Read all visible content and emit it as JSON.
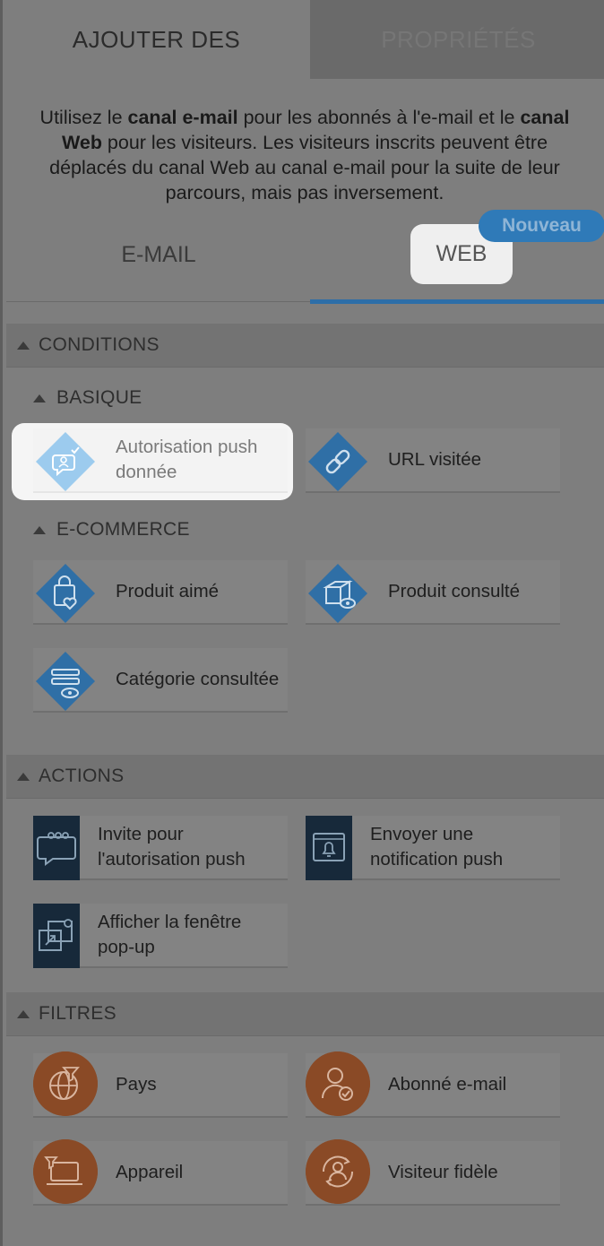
{
  "tabs": {
    "add": "AJOUTER DES",
    "properties": "PROPRIÉTÉS"
  },
  "intro": {
    "p1": "Utilisez le ",
    "b1": "canal e-mail",
    "p2": " pour les abonnés à l'e-mail et le ",
    "b2": "canal Web",
    "p3": " pour les visiteurs. Les visiteurs inscrits peuvent être déplacés du canal Web au canal e-mail pour la suite de leur parcours, mais pas inversement."
  },
  "channels": {
    "email": "E-MAIL",
    "web": "WEB",
    "badge": "Nouveau"
  },
  "sections": {
    "conditions": "CONDITIONS",
    "basique": "BASIQUE",
    "ecommerce": "E-COMMERCE",
    "actions": "ACTIONS",
    "filtres": "FILTRES"
  },
  "basique_items": [
    "Autorisation push donnée",
    "URL visitée"
  ],
  "ecommerce_items": [
    "Produit aimé",
    "Produit consulté",
    "Catégorie consultée"
  ],
  "action_items": [
    "Invite pour l'autorisation push",
    "Envoyer une notification push",
    "Afficher la fenêtre pop-up"
  ],
  "filter_items": [
    "Pays",
    "Abonné e-mail",
    "Appareil",
    "Visiteur fidèle"
  ],
  "colors": {
    "accent": "#2d6ea8",
    "condition_icon": "#2f6fa6",
    "action_icon": "#17293a",
    "filter_icon": "#8a4a26",
    "highlight": "#f5f5f5"
  }
}
